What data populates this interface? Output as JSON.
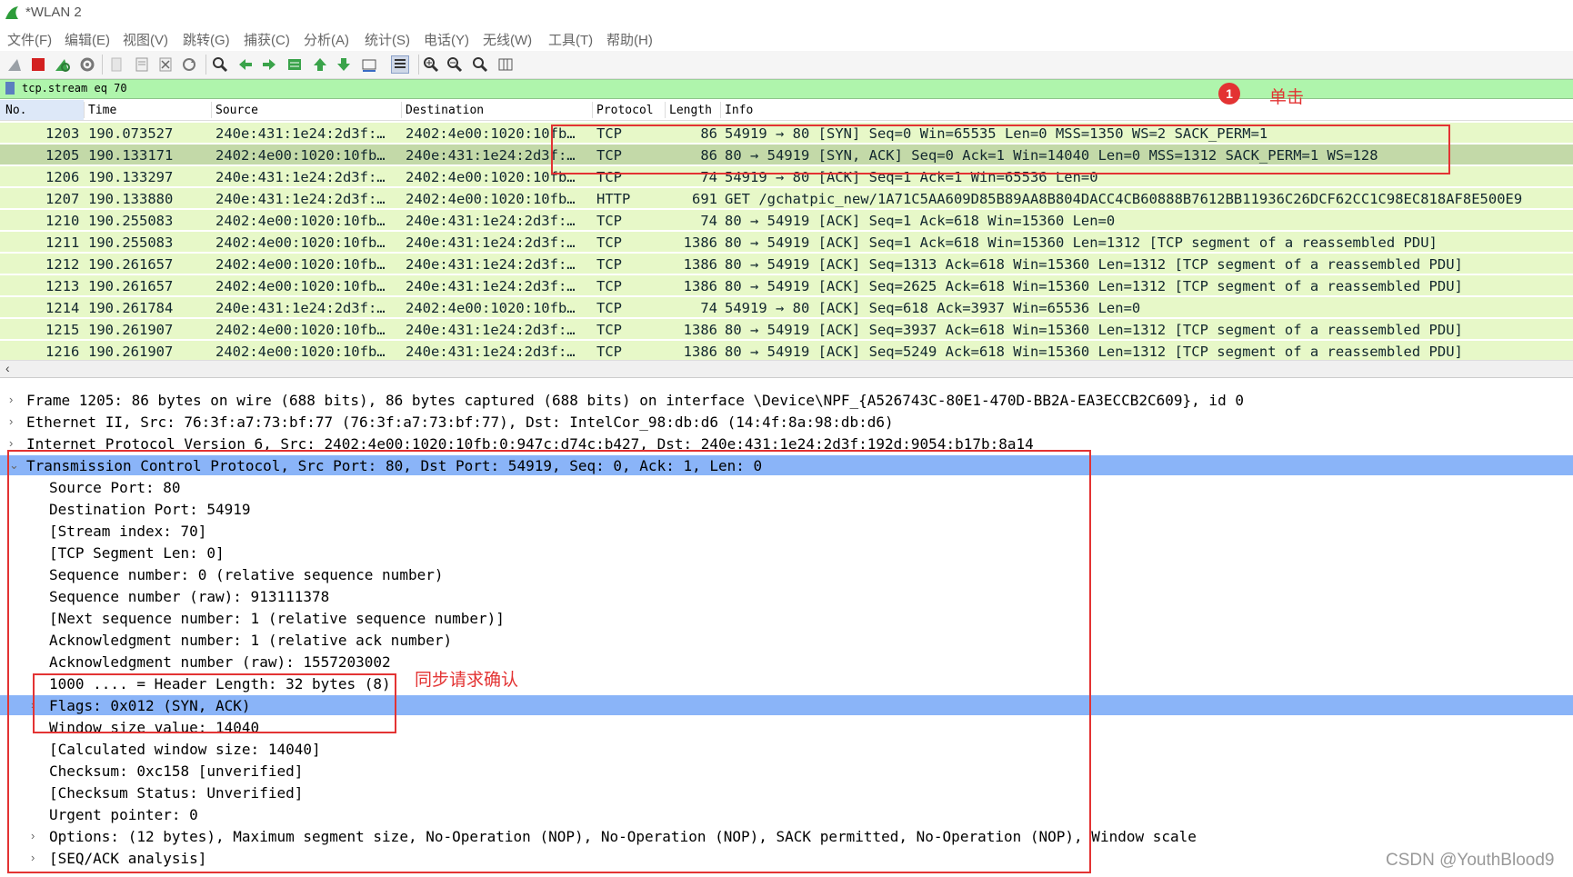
{
  "window": {
    "title": "*WLAN 2"
  },
  "menu": [
    "文件(F)",
    "编辑(E)",
    "视图(V)",
    "跳转(G)",
    "捕获(C)",
    "分析(A)",
    "统计(S)",
    "电话(Y)",
    "无线(W)",
    "工具(T)",
    "帮助(H)"
  ],
  "toolbar": {
    "icons": [
      "shark-fin-start-icon",
      "stop-icon",
      "restart-icon",
      "options-gear-icon",
      "open-file-icon",
      "save-file-icon",
      "close-file-icon",
      "reload-icon",
      "find-icon",
      "go-back-icon",
      "go-forward-icon",
      "go-to-packet-icon",
      "first-packet-icon",
      "last-packet-icon",
      "autoscroll-icon",
      "colorize-icon",
      "zoom-in-icon",
      "zoom-out-icon",
      "normal-size-icon",
      "resize-columns-icon"
    ]
  },
  "filter": {
    "value": "tcp.stream eq 70"
  },
  "packet_list": {
    "columns": [
      "No.",
      "Time",
      "Source",
      "Destination",
      "Protocol",
      "Length",
      "Info"
    ],
    "rows": [
      {
        "no": "1203",
        "time": "190.073527",
        "src": "240e:431:1e24:2d3f:…",
        "dst": "2402:4e00:1020:10fb…",
        "proto": "TCP",
        "len": "86",
        "info": "54919 → 80 [SYN] Seq=0 Win=65535 Len=0 MSS=1350 WS=2 SACK_PERM=1"
      },
      {
        "no": "1205",
        "time": "190.133171",
        "src": "2402:4e00:1020:10fb…",
        "dst": "240e:431:1e24:2d3f:…",
        "proto": "TCP",
        "len": "86",
        "info": "80 → 54919 [SYN, ACK] Seq=0 Ack=1 Win=14040 Len=0 MSS=1312 SACK_PERM=1 WS=128"
      },
      {
        "no": "1206",
        "time": "190.133297",
        "src": "240e:431:1e24:2d3f:…",
        "dst": "2402:4e00:1020:10fb…",
        "proto": "TCP",
        "len": "74",
        "info": "54919 → 80 [ACK] Seq=1 Ack=1 Win=65536 Len=0"
      },
      {
        "no": "1207",
        "time": "190.133880",
        "src": "240e:431:1e24:2d3f:…",
        "dst": "2402:4e00:1020:10fb…",
        "proto": "HTTP",
        "len": "691",
        "info": "GET /gchatpic_new/1A71C5AA609D85B89AA8B804DACC4CB60888B7612BB11936C26DCF62CC1C98EC818AF8E500E9"
      },
      {
        "no": "1210",
        "time": "190.255083",
        "src": "2402:4e00:1020:10fb…",
        "dst": "240e:431:1e24:2d3f:…",
        "proto": "TCP",
        "len": "74",
        "info": "80 → 54919 [ACK] Seq=1 Ack=618 Win=15360 Len=0"
      },
      {
        "no": "1211",
        "time": "190.255083",
        "src": "2402:4e00:1020:10fb…",
        "dst": "240e:431:1e24:2d3f:…",
        "proto": "TCP",
        "len": "1386",
        "info": "80 → 54919 [ACK] Seq=1 Ack=618 Win=15360 Len=1312 [TCP segment of a reassembled PDU]"
      },
      {
        "no": "1212",
        "time": "190.261657",
        "src": "2402:4e00:1020:10fb…",
        "dst": "240e:431:1e24:2d3f:…",
        "proto": "TCP",
        "len": "1386",
        "info": "80 → 54919 [ACK] Seq=1313 Ack=618 Win=15360 Len=1312 [TCP segment of a reassembled PDU]"
      },
      {
        "no": "1213",
        "time": "190.261657",
        "src": "2402:4e00:1020:10fb…",
        "dst": "240e:431:1e24:2d3f:…",
        "proto": "TCP",
        "len": "1386",
        "info": "80 → 54919 [ACK] Seq=2625 Ack=618 Win=15360 Len=1312 [TCP segment of a reassembled PDU]"
      },
      {
        "no": "1214",
        "time": "190.261784",
        "src": "240e:431:1e24:2d3f:…",
        "dst": "2402:4e00:1020:10fb…",
        "proto": "TCP",
        "len": "74",
        "info": "54919 → 80 [ACK] Seq=618 Ack=3937 Win=65536 Len=0"
      },
      {
        "no": "1215",
        "time": "190.261907",
        "src": "2402:4e00:1020:10fb…",
        "dst": "240e:431:1e24:2d3f:…",
        "proto": "TCP",
        "len": "1386",
        "info": "80 → 54919 [ACK] Seq=3937 Ack=618 Win=15360 Len=1312 [TCP segment of a reassembled PDU]"
      },
      {
        "no": "1216",
        "time": "190.261907",
        "src": "2402:4e00:1020:10fb…",
        "dst": "240e:431:1e24:2d3f:…",
        "proto": "TCP",
        "len": "1386",
        "info": "80 → 54919 [ACK] Seq=5249 Ack=618 Win=15360 Len=1312 [TCP segment of a reassembled PDU]"
      }
    ]
  },
  "details": [
    {
      "expander": ">",
      "text": "Frame 1205: 86 bytes on wire (688 bits), 86 bytes captured (688 bits) on interface \\Device\\NPF_{A526743C-80E1-470D-BB2A-EA3ECCB2C609}, id 0"
    },
    {
      "expander": ">",
      "text": "Ethernet II, Src: 76:3f:a7:73:bf:77 (76:3f:a7:73:bf:77), Dst: IntelCor_98:db:d6 (14:4f:8a:98:db:d6)"
    },
    {
      "expander": ">",
      "text": "Internet Protocol Version 6, Src: 2402:4e00:1020:10fb:0:947c:d74c:b427, Dst: 240e:431:1e24:2d3f:192d:9054:b17b:8a14"
    },
    {
      "expander": "v",
      "text": "Transmission Control Protocol, Src Port: 80, Dst Port: 54919, Seq: 0, Ack: 1, Len: 0"
    },
    {
      "expander": "",
      "text": "Source Port: 80"
    },
    {
      "expander": "",
      "text": "Destination Port: 54919"
    },
    {
      "expander": "",
      "text": "[Stream index: 70]"
    },
    {
      "expander": "",
      "text": "[TCP Segment Len: 0]"
    },
    {
      "expander": "",
      "text": "Sequence number: 0    (relative sequence number)"
    },
    {
      "expander": "",
      "text": "Sequence number (raw): 913111378"
    },
    {
      "expander": "",
      "text": "[Next sequence number: 1    (relative sequence number)]"
    },
    {
      "expander": "",
      "text": "Acknowledgment number: 1    (relative ack number)"
    },
    {
      "expander": "",
      "text": "Acknowledgment number (raw): 1557203002"
    },
    {
      "expander": "",
      "text": "1000 .... = Header Length: 32 bytes (8)"
    },
    {
      "expander": ">",
      "text": "Flags: 0x012 (SYN, ACK)"
    },
    {
      "expander": "",
      "text": "Window size value: 14040"
    },
    {
      "expander": "",
      "text": "[Calculated window size: 14040]"
    },
    {
      "expander": "",
      "text": "Checksum: 0xc158 [unverified]"
    },
    {
      "expander": "",
      "text": "[Checksum Status: Unverified]"
    },
    {
      "expander": "",
      "text": "Urgent pointer: 0"
    },
    {
      "expander": ">",
      "text": "Options: (12 bytes), Maximum segment size, No-Operation (NOP), No-Operation (NOP), SACK permitted, No-Operation (NOP), Window scale"
    },
    {
      "expander": ">",
      "text": "[SEQ/ACK analysis]"
    }
  ],
  "annotations": {
    "badge": "1",
    "click_label": "单击",
    "syn_label": "同步请求确认",
    "watermark": "CSDN @YouthBlood9"
  },
  "colors": {
    "accent_red": "#e33333",
    "row_green": "#e7f8c8",
    "selected_green": "#c3d9a8",
    "detail_highlight": "#8ab4f8",
    "filter_green": "#aff5ac"
  }
}
